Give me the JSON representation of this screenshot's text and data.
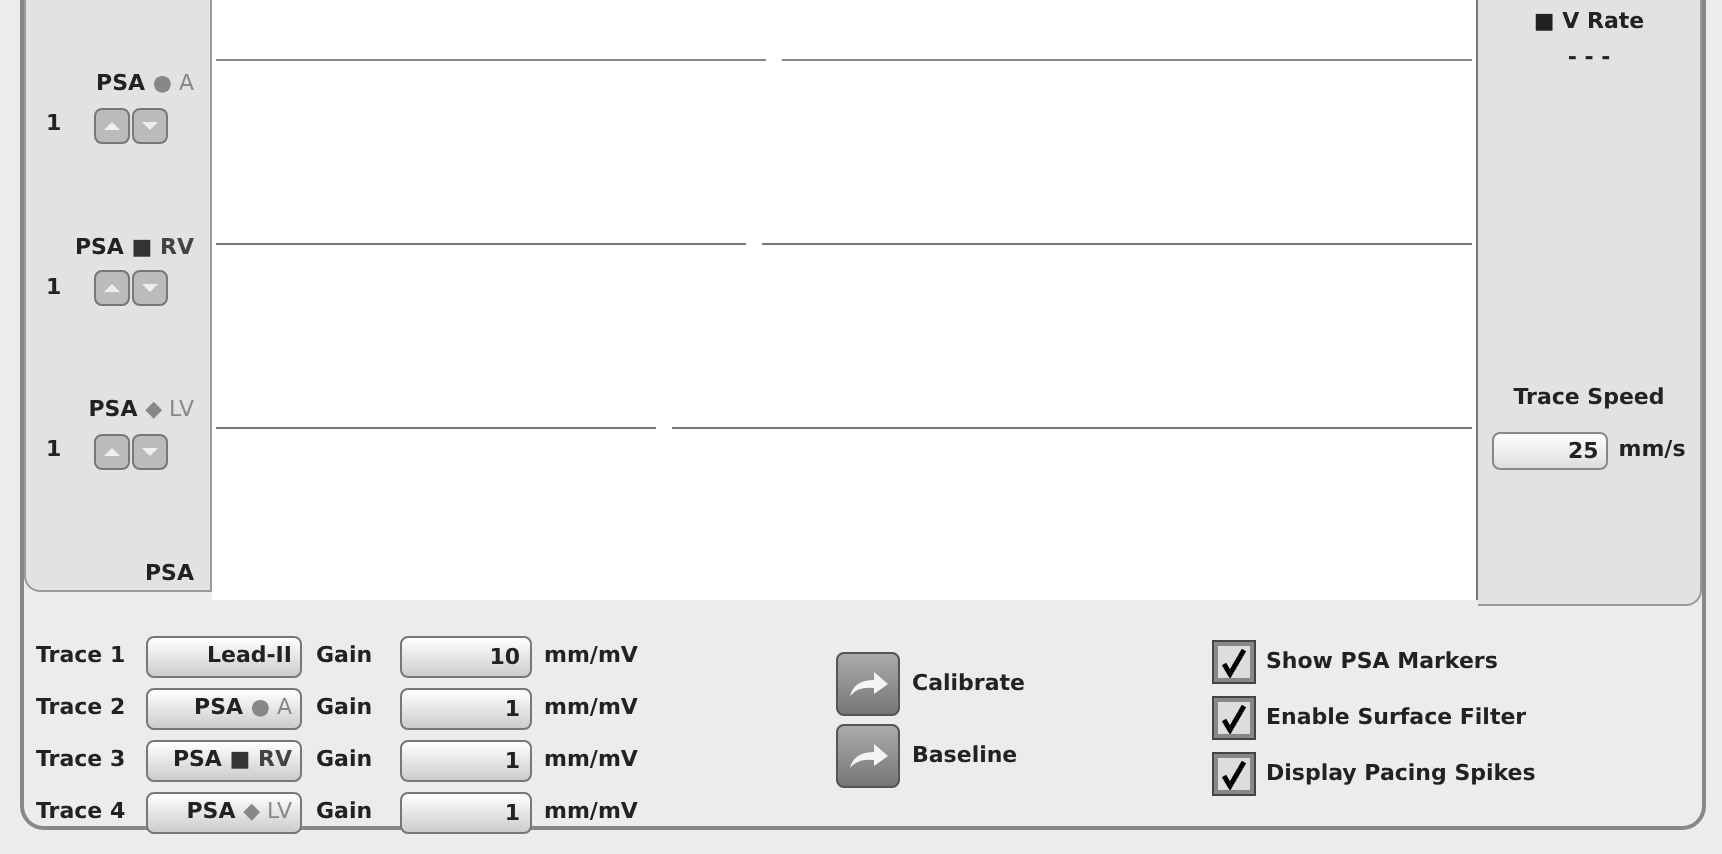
{
  "channels": [
    {
      "label": "PSA",
      "marker": "●",
      "chamber": "A",
      "value": "1"
    },
    {
      "label": "PSA",
      "marker": "■",
      "chamber": "RV",
      "value": "1"
    },
    {
      "label": "PSA",
      "marker": "◆",
      "chamber": "LV",
      "value": "1"
    }
  ],
  "left_footer": "PSA",
  "rate": {
    "marker": "■",
    "label": "V Rate",
    "value": "- - -"
  },
  "trace_speed": {
    "label": "Trace Speed",
    "value": "25",
    "unit": "mm/s"
  },
  "traces": [
    {
      "label": "Trace 1",
      "source": {
        "label": "Lead-II"
      },
      "gain_label": "Gain",
      "gain": "10",
      "unit": "mm/mV"
    },
    {
      "label": "Trace 2",
      "source": {
        "label": "PSA",
        "marker": "●",
        "chamber": "A"
      },
      "gain_label": "Gain",
      "gain": "1",
      "unit": "mm/mV"
    },
    {
      "label": "Trace 3",
      "source": {
        "label": "PSA",
        "marker": "■",
        "chamber": "RV"
      },
      "gain_label": "Gain",
      "gain": "1",
      "unit": "mm/mV"
    },
    {
      "label": "Trace 4",
      "source": {
        "label": "PSA",
        "marker": "◆",
        "chamber": "LV"
      },
      "gain_label": "Gain",
      "gain": "1",
      "unit": "mm/mV"
    }
  ],
  "actions": [
    "Calibrate",
    "Baseline"
  ],
  "options": [
    {
      "label": "Show PSA Markers",
      "checked": true
    },
    {
      "label": "Enable Surface Filter",
      "checked": true
    },
    {
      "label": "Display Pacing Spikes",
      "checked": true
    }
  ]
}
